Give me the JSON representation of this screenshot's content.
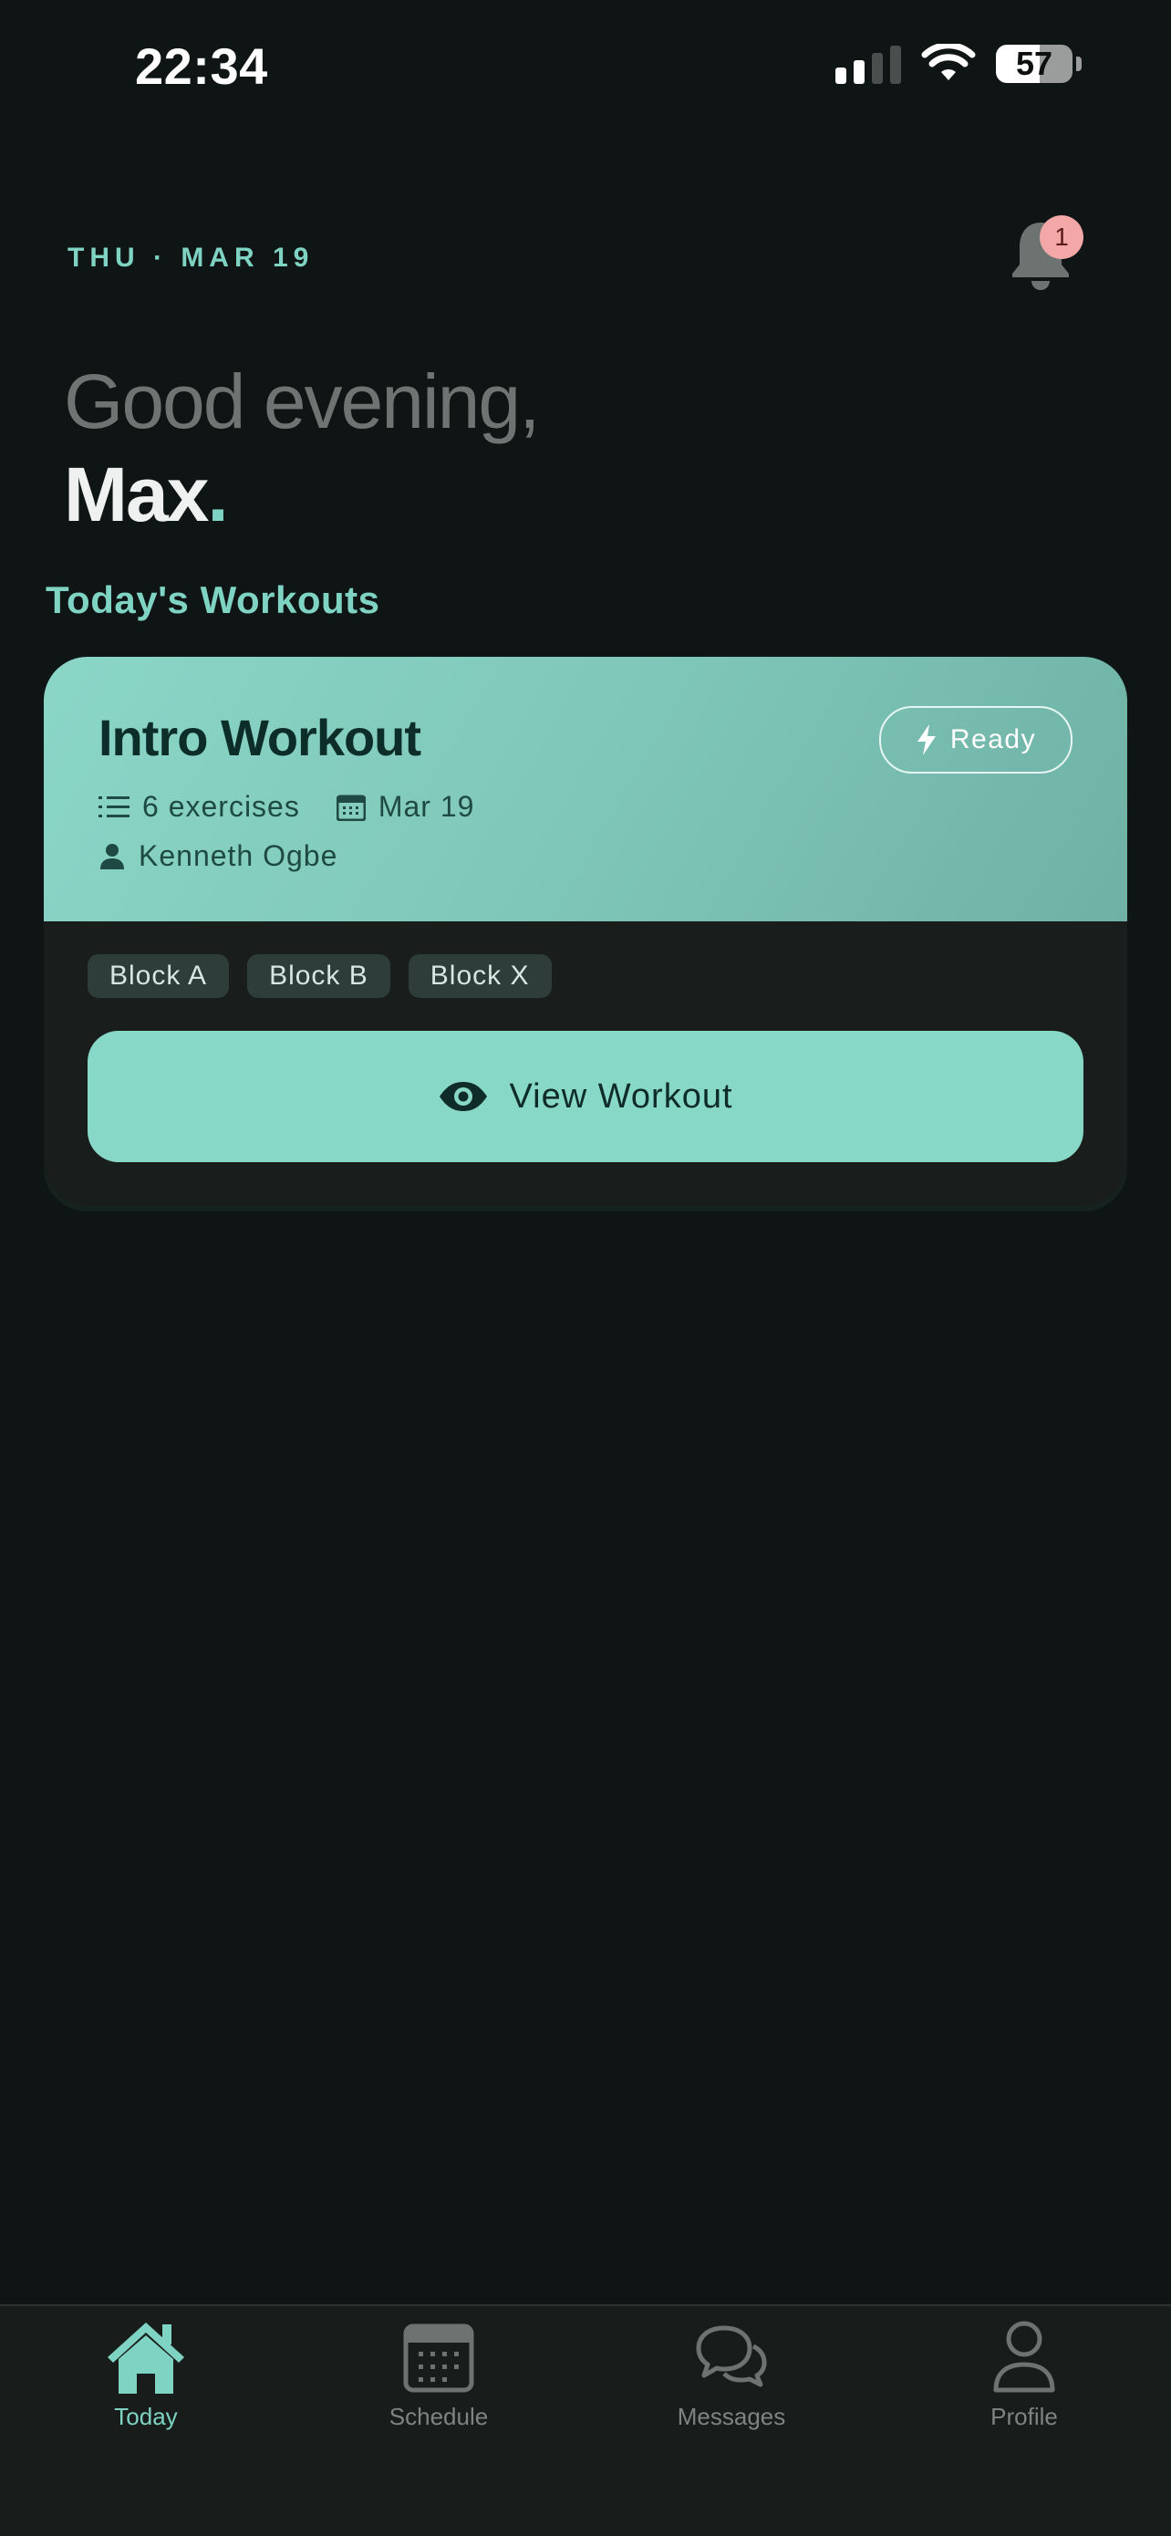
{
  "status_bar": {
    "time": "22:34",
    "battery": "57",
    "battery_level": 0.57
  },
  "header": {
    "date": "THU · MAR 19",
    "notification_count": "1",
    "greeting": "Good evening,",
    "name": "Max",
    "name_dot": "."
  },
  "section_title": "Today's Workouts",
  "workout_card": {
    "title": "Intro Workout",
    "status": "Ready",
    "exercises": "6 exercises",
    "date": "Mar 19",
    "coach": "Kenneth Ogbe",
    "blocks": [
      "Block A",
      "Block B",
      "Block X"
    ],
    "view_label": "View Workout"
  },
  "tabs": [
    {
      "label": "Today",
      "icon": "home-icon",
      "active": true
    },
    {
      "label": "Schedule",
      "icon": "calendar-icon",
      "active": false
    },
    {
      "label": "Messages",
      "icon": "chat-icon",
      "active": false
    },
    {
      "label": "Profile",
      "icon": "user-icon",
      "active": false
    }
  ],
  "colors": {
    "accent": "#7fd3c3",
    "background": "#0f1514",
    "card": "#191e1d",
    "badge": "#f4a7a7"
  }
}
